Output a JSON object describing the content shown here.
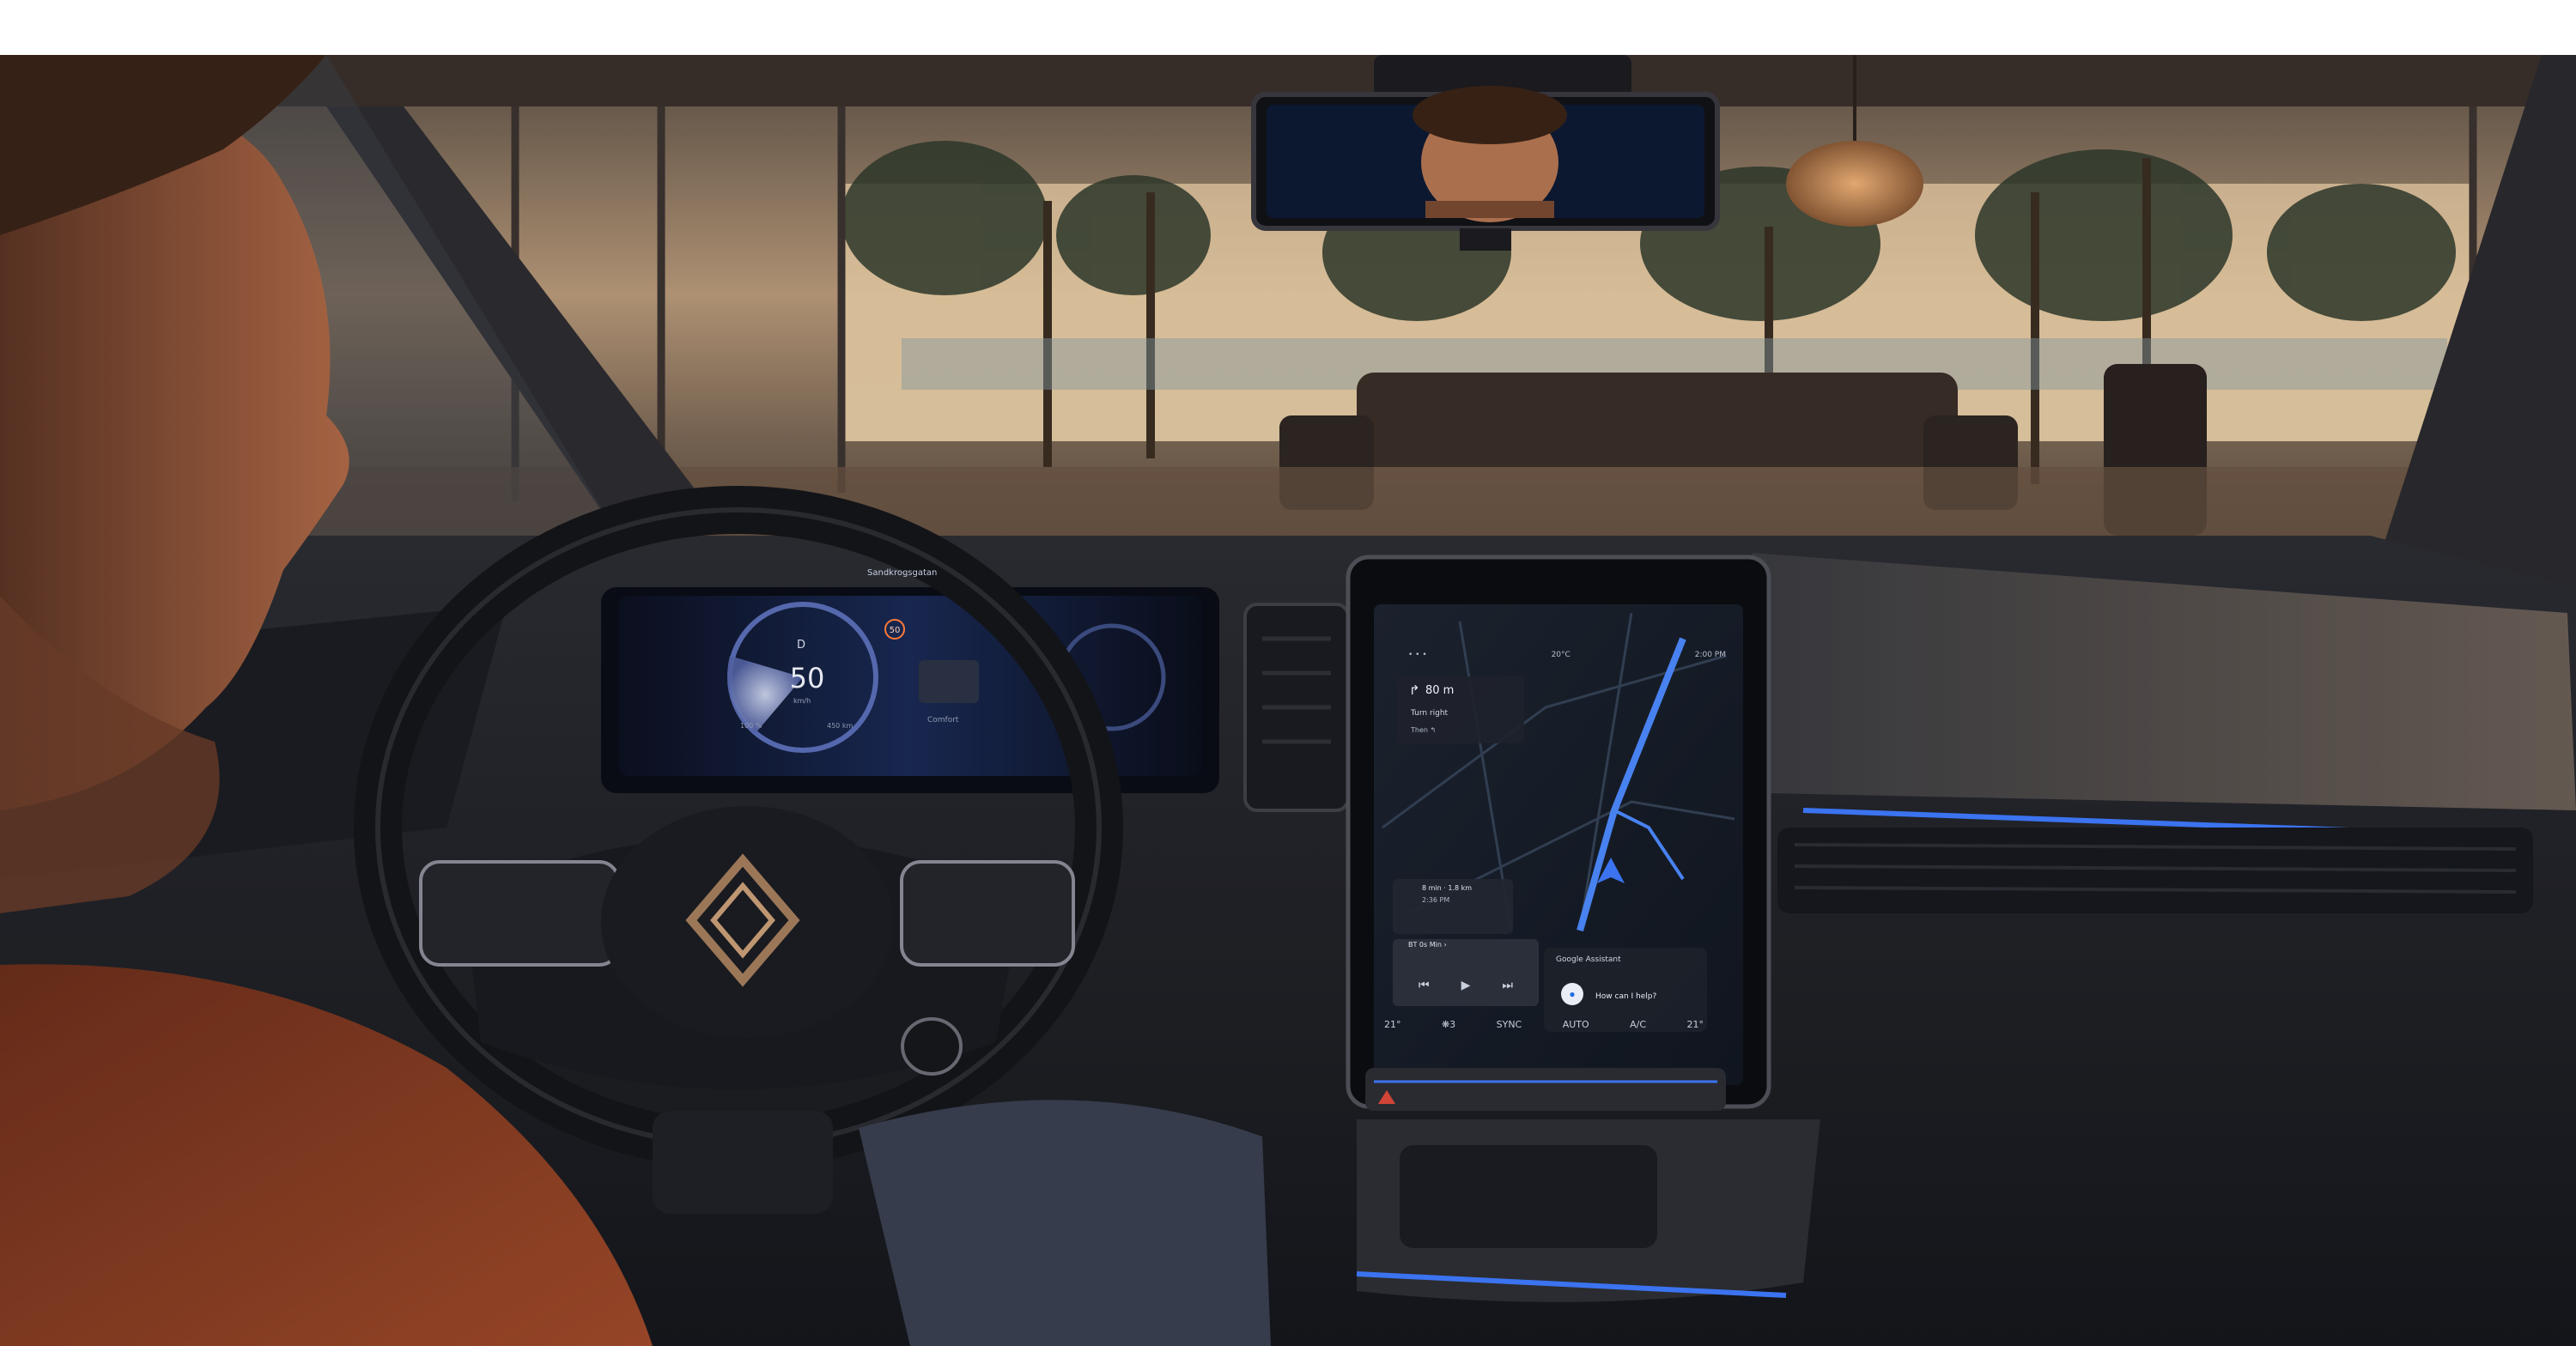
{
  "scene": {
    "brand_logo": "renault-diamond-logo"
  },
  "instrument_cluster": {
    "street_name": "Sandkrogsgatan",
    "gear": "D",
    "speed": "50",
    "speed_unit": "km/h",
    "speed_limit": "50",
    "drive_mode": "Comfort",
    "range_left": "100 %",
    "range_right": "450 km"
  },
  "center_screen": {
    "status_bar": {
      "left_icons": "• • •",
      "temp": "20°C",
      "time": "2:00 PM"
    },
    "navigation": {
      "distance": "80 m",
      "instruction": "Turn right",
      "next": "Then ↰",
      "arrow": "↱"
    },
    "eta": {
      "line1": "8 min · 1.8 km",
      "line2": "2:36 PM"
    },
    "media": {
      "title": "BT 0s Min ›",
      "prev": "⏮",
      "play": "▶",
      "next": "⏭"
    },
    "assistant": {
      "title": "Google Assistant",
      "prompt": "How can I help?",
      "mic": "●"
    },
    "climate": {
      "left_temp": "21°",
      "fan": "❋3",
      "sync": "SYNC",
      "auto": "AUTO",
      "ac": "A/C",
      "right_temp": "21°"
    }
  },
  "colors": {
    "ambient_blue": "#3f7bff",
    "sky_glow": "#f2c58a",
    "screen_map_line": "#4d8bff"
  }
}
